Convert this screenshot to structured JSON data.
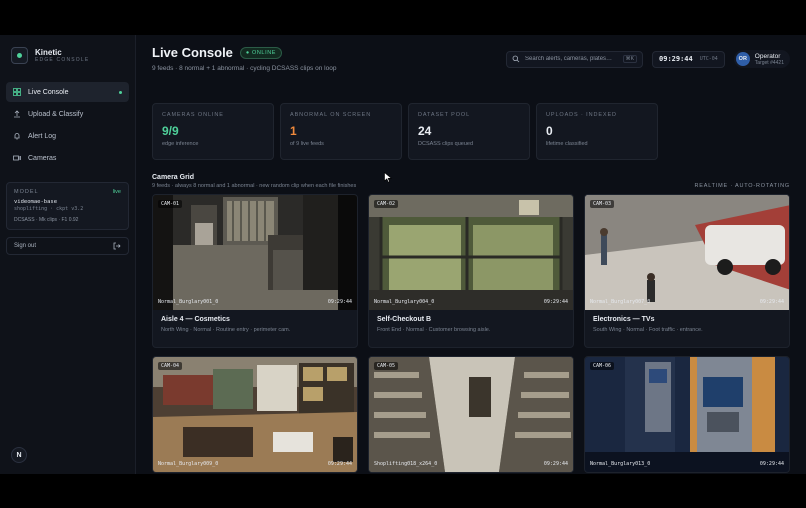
{
  "brand": {
    "name": "Kinetic",
    "subtitle": "EDGE CONSOLE"
  },
  "nav": [
    {
      "label": "Live Console",
      "icon": "grid-icon",
      "active": true
    },
    {
      "label": "Upload & Classify",
      "icon": "upload-icon",
      "active": false
    },
    {
      "label": "Alert Log",
      "icon": "bell-icon",
      "active": false
    },
    {
      "label": "Cameras",
      "icon": "camera-icon",
      "active": false
    }
  ],
  "model": {
    "heading": "MODEL",
    "status": "live",
    "name": "videomae-base",
    "sub": "shoplifting · ckpt v3.2",
    "stats": "DCSASS · Mk clips · F1 0.92"
  },
  "signout": {
    "label": "Sign out"
  },
  "corner_badge": "N",
  "header": {
    "title": "Live Console",
    "badge": "● ONLINE",
    "subtitle": "9 feeds · 8 normal + 1 abnormal · cycling DCSASS clips on loop"
  },
  "search": {
    "placeholder": "Search alerts, cameras, plates…",
    "shortcut": "⌘K"
  },
  "clock": {
    "time": "09:29:44",
    "tz": "UTC-04"
  },
  "user": {
    "initials": "OR",
    "name": "Operator",
    "sub": "Target #4421"
  },
  "stats": [
    {
      "label": "CAMERAS ONLINE",
      "value": "9/9",
      "sub": "edge inference",
      "color": "green"
    },
    {
      "label": "ABNORMAL ON SCREEN",
      "value": "1",
      "sub": "of 9 live feeds",
      "color": "orange"
    },
    {
      "label": "DATASET POOL",
      "value": "24",
      "sub": "DCSASS clips queued",
      "color": "white"
    },
    {
      "label": "UPLOADS · INDEXED",
      "value": "0",
      "sub": "lifetime classified",
      "color": "white"
    }
  ],
  "grid": {
    "title": "Camera Grid",
    "subtitle": "9 feeds · always 8 normal and 1 abnormal · new random clip when each file finishes",
    "mode": "REALTIME · AUTO-ROTATING"
  },
  "cameras": [
    {
      "tag": "CAM-01",
      "clip": "Normal_Burglary001_0",
      "time": "09:29:44",
      "name": "Aisle 4 — Cosmetics",
      "desc": "North Wing · Normal · Routine entry · perimeter cam."
    },
    {
      "tag": "CAM-02",
      "clip": "Normal_Burglary004_0",
      "time": "09:29:44",
      "name": "Self-Checkout B",
      "desc": "Front End · Normal · Customer browsing aisle."
    },
    {
      "tag": "CAM-03",
      "clip": "Normal_Burglary007_0",
      "time": "09:29:44",
      "name": "Electronics — TVs",
      "desc": "South Wing · Normal · Foot traffic · entrance."
    },
    {
      "tag": "CAM-04",
      "clip": "Normal_Burglary009_0",
      "time": "09:29:44",
      "name": "",
      "desc": ""
    },
    {
      "tag": "CAM-05",
      "clip": "Shoplifting018_x264_0",
      "time": "09:29:44",
      "name": "",
      "desc": ""
    },
    {
      "tag": "CAM-06",
      "clip": "Normal_Burglary013_0",
      "time": "09:29:44",
      "name": "",
      "desc": ""
    }
  ],
  "colors": {
    "accent_green": "#4fd19a",
    "alert_orange": "#f08a3c",
    "background": "#0c0f16"
  }
}
